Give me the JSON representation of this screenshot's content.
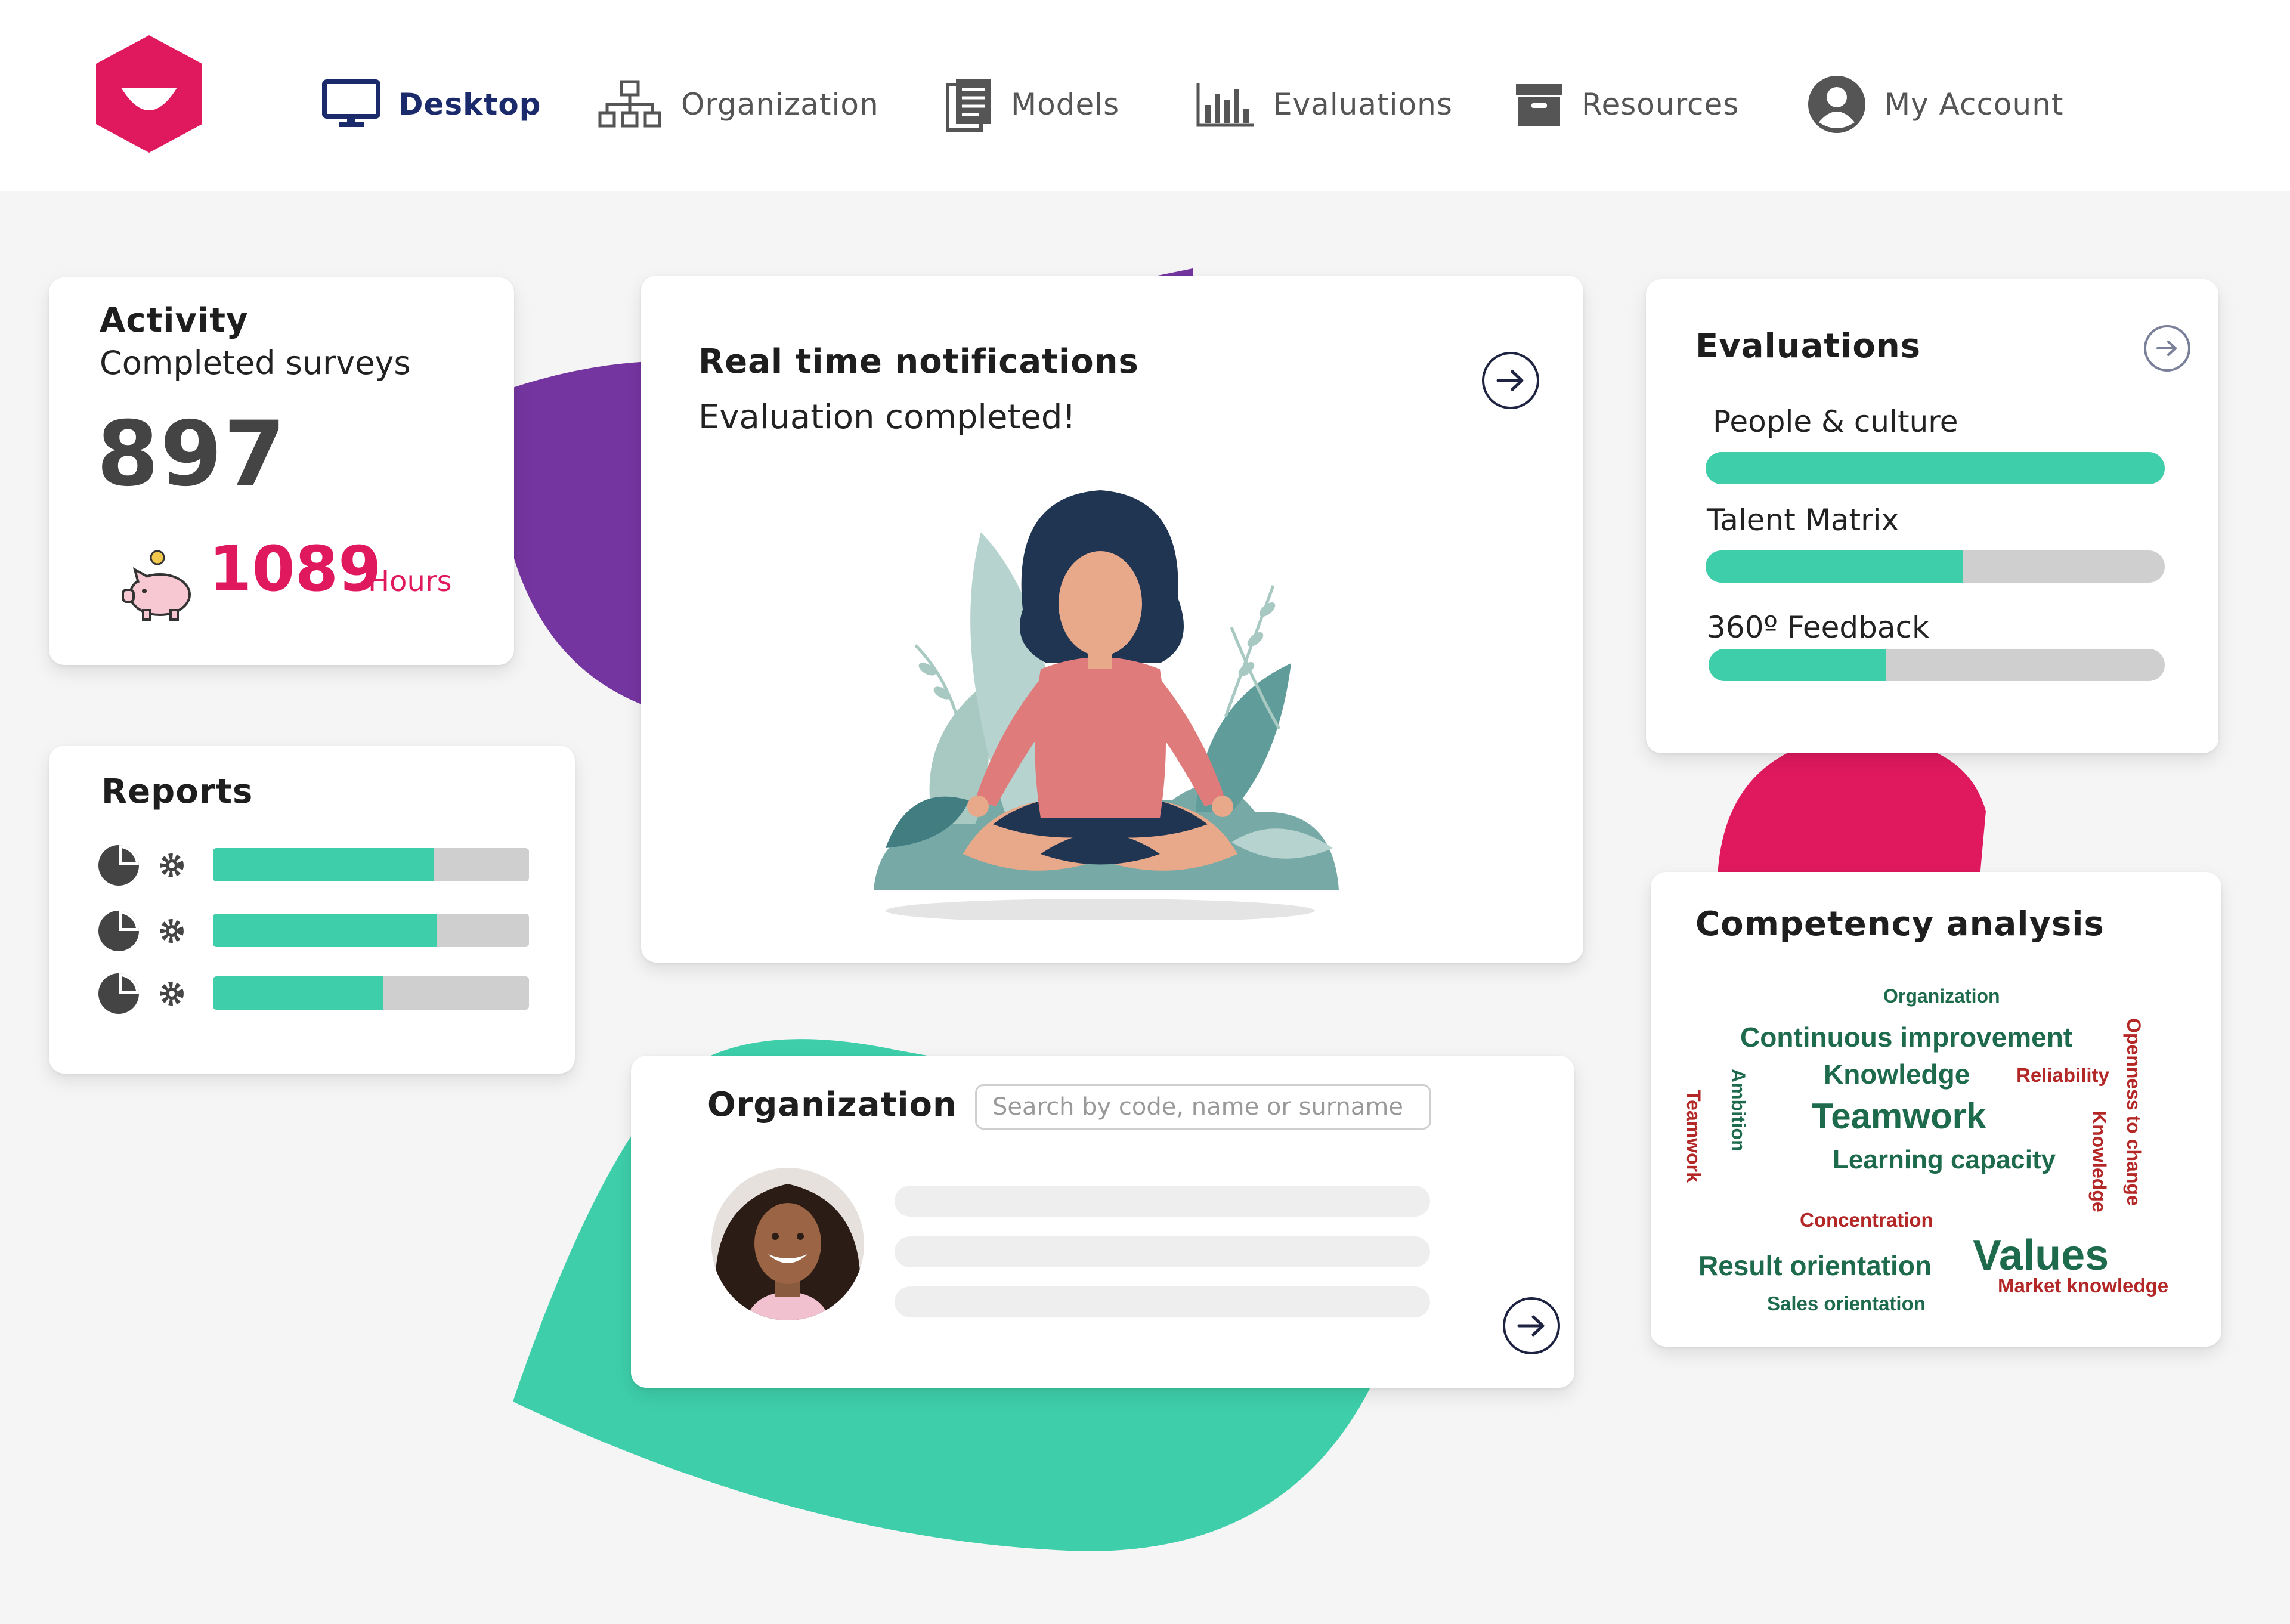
{
  "nav": {
    "items": [
      {
        "label": "Desktop",
        "icon": "monitor-icon",
        "active": true
      },
      {
        "label": "Organization",
        "icon": "org-chart-icon",
        "active": false
      },
      {
        "label": "Models",
        "icon": "document-icon",
        "active": false
      },
      {
        "label": "Evaluations",
        "icon": "bar-chart-icon",
        "active": false
      },
      {
        "label": "Resources",
        "icon": "archive-icon",
        "active": false
      },
      {
        "label": "My Account",
        "icon": "user-icon",
        "active": false
      }
    ]
  },
  "activity": {
    "title": "Activity",
    "subtitle": "Completed surveys",
    "count": "897",
    "hours_value": "1089",
    "hours_label": "Hours"
  },
  "reports": {
    "title": "Reports",
    "rows": [
      {
        "progress": 0.7
      },
      {
        "progress": 0.71
      },
      {
        "progress": 0.54
      }
    ]
  },
  "notifications": {
    "title": "Real time notifications",
    "message": "Evaluation completed!"
  },
  "evaluations": {
    "title": "Evaluations",
    "items": [
      {
        "label": "People & culture",
        "progress": 1.0
      },
      {
        "label": "Talent Matrix",
        "progress": 0.56
      },
      {
        "label": "360º Feedback",
        "progress": 0.39
      }
    ]
  },
  "organization": {
    "title": "Organization",
    "search_placeholder": "Search by code, name or surname"
  },
  "competency": {
    "title": "Competency analysis",
    "words": [
      {
        "text": "Organization",
        "color": "#1d6b4c"
      },
      {
        "text": "Continuous improvement",
        "color": "#1d6b4c"
      },
      {
        "text": "Knowledge",
        "color": "#1d6b4c"
      },
      {
        "text": "Reliability",
        "color": "#b32727"
      },
      {
        "text": "Teamwork",
        "color": "#1d6b4c"
      },
      {
        "text": "Learning capacity",
        "color": "#1d6b4c"
      },
      {
        "text": "Concentration",
        "color": "#b32727"
      },
      {
        "text": "Result orientation",
        "color": "#1d6b4c"
      },
      {
        "text": "Values",
        "color": "#1d6b4c"
      },
      {
        "text": "Market knowledge",
        "color": "#b32727"
      },
      {
        "text": "Sales orientation",
        "color": "#1d6b4c"
      },
      {
        "text": "Teamwork",
        "color": "#b32727"
      },
      {
        "text": "Ambition",
        "color": "#1d6b4c"
      },
      {
        "text": "Knowledge",
        "color": "#b32727"
      },
      {
        "text": "Openness to change",
        "color": "#b32727"
      }
    ]
  },
  "colors": {
    "brand": "#e0195e",
    "accent": "#3ecfaa",
    "purple": "#7535a0",
    "navy": "#1b2a6b"
  }
}
